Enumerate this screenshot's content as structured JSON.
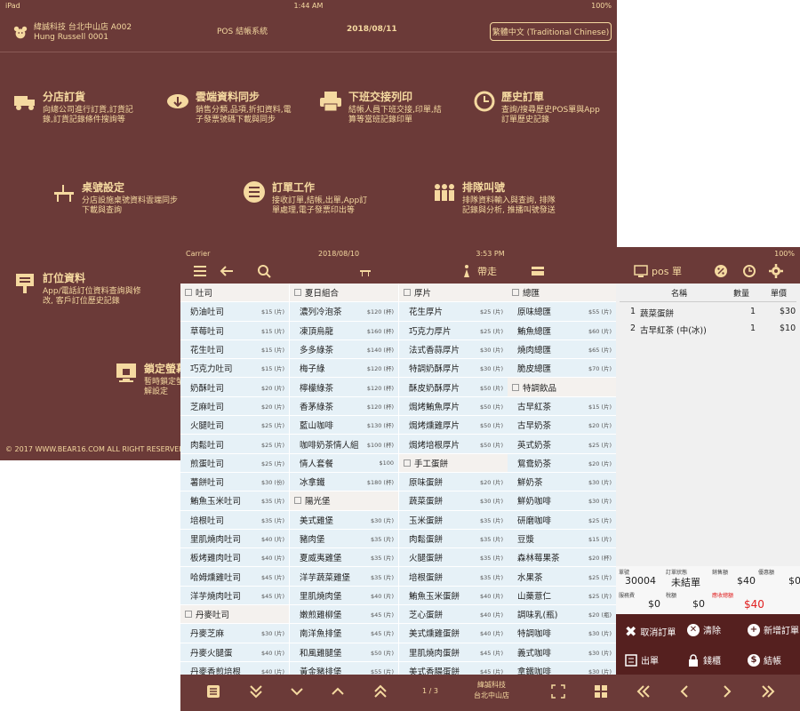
{
  "back": {
    "status": {
      "carrier": "iPad",
      "time": "1:44 AM",
      "battery": "100%"
    },
    "header": {
      "company": "緯誠科技 台北中山店 A002",
      "user": "Hung Russell 0001",
      "title": "POS 結帳系統",
      "date": "2018/08/11",
      "language_button": "繁體中文 (Traditional Chinese)"
    },
    "menu": [
      {
        "title": "分店訂貨",
        "desc1": "向總公司進行訂貨,訂貨記",
        "desc2": "錄,訂貨記錄條件搜詢等",
        "icon": "truck-icon"
      },
      {
        "title": "雲端資料同步",
        "desc1": "銷售分類,品項,折扣資料,電",
        "desc2": "子發票號碼下載與同步",
        "icon": "cloud-sync-icon"
      },
      {
        "title": "下班交接列印",
        "desc1": "結帳人員下班交接,印單,結",
        "desc2": "算等當班記錄印單",
        "icon": "printer-icon"
      },
      {
        "title": "歷史訂單",
        "desc1": "查詢/搜尋歷史POS單與App",
        "desc2": "訂單歷史記錄",
        "icon": "history-icon"
      },
      {
        "title": "桌號設定",
        "desc1": "分店設施桌號資料雲端同步",
        "desc2": "下載與查詢",
        "icon": "table-icon"
      },
      {
        "title": "訂單工作",
        "desc1": "接收訂單,結帳,出單,App訂",
        "desc2": "單處理,電子發票印出等",
        "icon": "list-icon"
      },
      {
        "title": "排隊叫號",
        "desc1": "排隊資料輸入與查詢, 排隊",
        "desc2": "記錄與分析, 推播叫號發送",
        "icon": "queue-icon"
      },
      {
        "title": "訂位資料",
        "desc1": "App/電話訂位資料查詢與修",
        "desc2": "改, 客戶訂位歷史記錄",
        "icon": "reservation-icon"
      },
      {
        "title": "鎖定螢幕",
        "desc1": "暫時鎖定螢",
        "desc2": "解設定",
        "icon": "lock-screen-icon"
      }
    ],
    "copyright": "© 2017 WWW.BEAR16.COM ALL RIGHT RESERVED"
  },
  "front": {
    "status": {
      "carrier": "Carrier",
      "date": "2018/08/10",
      "time": "3:53 PM",
      "battery": "100%"
    },
    "toolbar": {
      "takeout": "帶走",
      "pos_label": "pos 單"
    },
    "columns": [
      [
        {
          "name": "吐司",
          "cat": true
        },
        {
          "name": "奶油吐司",
          "price": "$15 (片)"
        },
        {
          "name": "草莓吐司",
          "price": "$15 (片)"
        },
        {
          "name": "花生吐司",
          "price": "$15 (片)"
        },
        {
          "name": "巧克力吐司",
          "price": "$15 (片)"
        },
        {
          "name": "奶酥吐司",
          "price": "$20 (片)"
        },
        {
          "name": "芝麻吐司",
          "price": "$20 (片)"
        },
        {
          "name": "火腿吐司",
          "price": "$25 (片)"
        },
        {
          "name": "肉鬆吐司",
          "price": "$25 (片)"
        },
        {
          "name": "煎蛋吐司",
          "price": "$25 (片)"
        },
        {
          "name": "薯餅吐司",
          "price": "$30 (份)"
        },
        {
          "name": "鮪魚玉米吐司",
          "price": "$35 (片)"
        },
        {
          "name": "培根吐司",
          "price": "$35 (片)"
        },
        {
          "name": "里肌燒肉吐司",
          "price": "$40 (片)"
        },
        {
          "name": "板烤雞肉吐司",
          "price": "$40 (片)"
        },
        {
          "name": "哈姆燻雞吐司",
          "price": "$45 (片)"
        },
        {
          "name": "洋芋燒肉吐司",
          "price": "$45 (片)"
        },
        {
          "name": "丹麥吐司",
          "cat": true
        },
        {
          "name": "丹麥芝麻",
          "price": "$30 (片)"
        },
        {
          "name": "丹麥火腿蛋",
          "price": "$40 (片)"
        },
        {
          "name": "丹麥香煎培根",
          "price": "$40 (片)"
        }
      ],
      [
        {
          "name": "夏日組合",
          "cat": true
        },
        {
          "name": "濃列冷泡茶",
          "price": "$120 (杯)"
        },
        {
          "name": "凍頂烏龍",
          "price": "$160 (杯)"
        },
        {
          "name": "多多綠茶",
          "price": "$140 (杯)"
        },
        {
          "name": "梅子綠",
          "price": "$120 (杯)"
        },
        {
          "name": "檸檬綠茶",
          "price": "$120 (杯)"
        },
        {
          "name": "香茅綠茶",
          "price": "$120 (杯)"
        },
        {
          "name": "藍山咖啡",
          "price": "$130 (杯)"
        },
        {
          "name": "咖啡奶茶情人組",
          "price": "$100 (杯)"
        },
        {
          "name": "情人套餐",
          "price": "$100"
        },
        {
          "name": "冰拿鐵",
          "price": "$180 (杯)"
        },
        {
          "name": "陽光堡",
          "cat": true
        },
        {
          "name": "美式雞堡",
          "price": "$30 (片)"
        },
        {
          "name": "豬肉堡",
          "price": "$35 (片)"
        },
        {
          "name": "夏威夷雞堡",
          "price": "$35 (片)"
        },
        {
          "name": "洋芋蔬菜雞堡",
          "price": "$35 (片)"
        },
        {
          "name": "里肌燒肉堡",
          "price": "$40 (片)"
        },
        {
          "name": "嫩煎雞柳堡",
          "price": "$45 (片)"
        },
        {
          "name": "南洋魚排堡",
          "price": "$45 (片)"
        },
        {
          "name": "和風雞腿堡",
          "price": "$50 (片)"
        },
        {
          "name": "黃金豬排堡",
          "price": "$55 (片)"
        }
      ],
      [
        {
          "name": "厚片",
          "cat": true
        },
        {
          "name": "花生厚片",
          "price": "$25 (片)"
        },
        {
          "name": "巧克力厚片",
          "price": "$25 (片)"
        },
        {
          "name": "法式香蒜厚片",
          "price": "$30 (片)"
        },
        {
          "name": "特調奶酥厚片",
          "price": "$30 (片)"
        },
        {
          "name": "酥皮奶酥厚片",
          "price": "$50 (片)"
        },
        {
          "name": "焗烤鮪魚厚片",
          "price": "$50 (片)"
        },
        {
          "name": "焗烤燻雞厚片",
          "price": "$50 (片)"
        },
        {
          "name": "焗烤培根厚片",
          "price": "$50 (片)"
        },
        {
          "name": "手工蛋餅",
          "cat": true
        },
        {
          "name": "原味蛋餅",
          "price": "$20 (片)"
        },
        {
          "name": "蔬菜蛋餅",
          "price": "$30 (片)"
        },
        {
          "name": "玉米蛋餅",
          "price": "$35 (片)"
        },
        {
          "name": "肉鬆蛋餅",
          "price": "$35 (片)"
        },
        {
          "name": "火腿蛋餅",
          "price": "$35 (片)"
        },
        {
          "name": "培根蛋餅",
          "price": "$35 (片)"
        },
        {
          "name": "鮪魚玉米蛋餅",
          "price": "$40 (片)"
        },
        {
          "name": "芝心蛋餅",
          "price": "$40 (片)"
        },
        {
          "name": "美式燻雞蛋餅",
          "price": "$40 (片)"
        },
        {
          "name": "里肌燒肉蛋餅",
          "price": "$45 (片)"
        },
        {
          "name": "美式香腸蛋餅",
          "price": "$45 (片)"
        }
      ],
      [
        {
          "name": "總匯",
          "cat": true
        },
        {
          "name": "原味總匯",
          "price": "$55 (片)"
        },
        {
          "name": "鮪魚總匯",
          "price": "$60 (片)"
        },
        {
          "name": "燒肉總匯",
          "price": "$65 (片)"
        },
        {
          "name": "脆皮總匯",
          "price": "$70 (片)"
        },
        {
          "name": "特調飲品",
          "cat": true
        },
        {
          "name": "古早紅茶",
          "price": "$15 (片)"
        },
        {
          "name": "古早奶茶",
          "price": "$20 (片)"
        },
        {
          "name": "英式奶茶",
          "price": "$25 (片)"
        },
        {
          "name": "鴛鴦奶茶",
          "price": "$20 (片)"
        },
        {
          "name": "鮮奶茶",
          "price": "$30 (片)"
        },
        {
          "name": "鮮奶咖啡",
          "price": "$30 (片)"
        },
        {
          "name": "研磨咖啡",
          "price": "$25 (片)"
        },
        {
          "name": "豆漿",
          "price": "$15 (片)"
        },
        {
          "name": "森林莓果茶",
          "price": "$20 (杯)"
        },
        {
          "name": "水果茶",
          "price": "$25 (片)"
        },
        {
          "name": "山藥薏仁",
          "price": "$25 (片)"
        },
        {
          "name": "調味乳(瓶)",
          "price": "$20 (瓶)"
        },
        {
          "name": "特調咖啡",
          "price": "$30 (片)"
        },
        {
          "name": "義式咖啡",
          "price": "$30 (片)"
        },
        {
          "name": "拿鐵咖啡",
          "price": "$30 (片)"
        }
      ]
    ],
    "order": {
      "headers": {
        "name": "名稱",
        "qty": "數量",
        "price": "單價"
      },
      "items": [
        {
          "idx": "1",
          "name": "蔬菜蛋餅",
          "qty": "1",
          "price": "$30"
        },
        {
          "idx": "2",
          "name": "古早紅茶 (中(冰))",
          "qty": "1",
          "price": "$10"
        }
      ]
    },
    "summary": {
      "order_no_label": "單號",
      "order_no": "30004",
      "status_label": "訂單狀態",
      "status": "未結單",
      "sales_label": "銷售額",
      "sales": "$40",
      "discount_label": "優惠額",
      "discount": "$0",
      "service_label": "服務費",
      "service": "$0",
      "tax_label": "稅額",
      "tax": "$0",
      "total_label": "應收總額",
      "total": "$40"
    },
    "actions": {
      "cancel": "取消訂單",
      "clear": "清除",
      "new_order": "新增訂單",
      "print": "出單",
      "drawer": "錢櫃",
      "checkout": "結帳"
    },
    "bottom": {
      "page": "1 / 3",
      "company": "緯誠科技",
      "store": "台北中山店"
    },
    "colors": {
      "bg": "#6b3a38",
      "accent": "#f5d9a0",
      "total_red": "#e02020",
      "action_bg": "#55201f"
    }
  }
}
